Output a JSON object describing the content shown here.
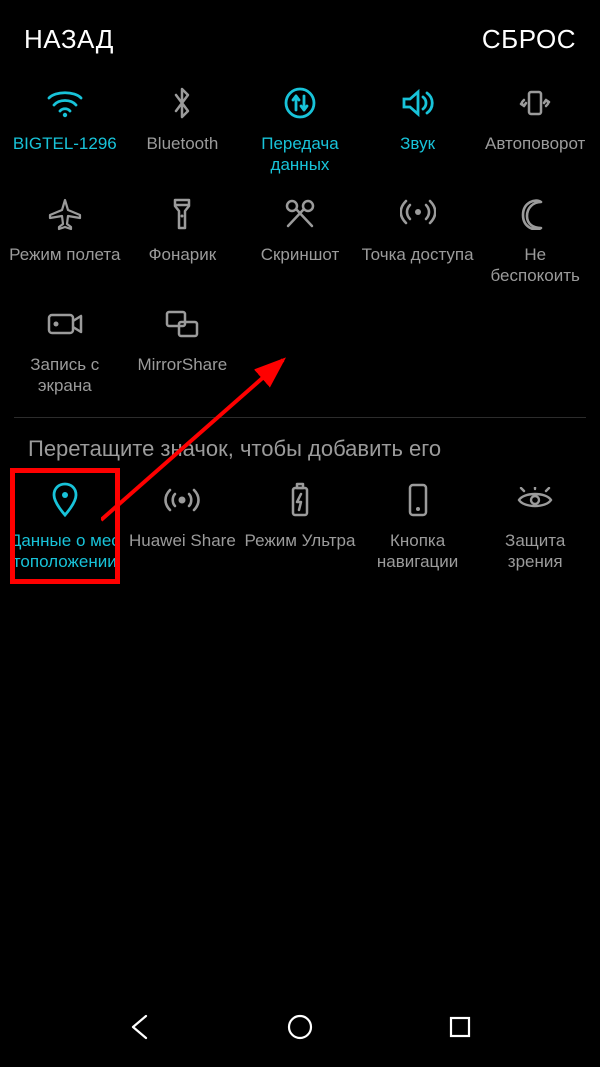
{
  "header": {
    "back": "НАЗАД",
    "reset": "СБРОС"
  },
  "hint": "Перетащите значок, чтобы добавить его",
  "colors": {
    "accent": "#18c3d9",
    "muted": "#9b9b9b",
    "highlight": "#ff0000"
  },
  "active_tiles": [
    {
      "id": "wifi",
      "label": "BIGTEL-1296",
      "active": true
    },
    {
      "id": "bluetooth",
      "label": "Bluetooth",
      "active": false
    },
    {
      "id": "data",
      "label": "Передача данных",
      "active": true
    },
    {
      "id": "sound",
      "label": "Звук",
      "active": true
    },
    {
      "id": "rotate",
      "label": "Автоповорот",
      "active": false
    },
    {
      "id": "airplane",
      "label": "Режим полета",
      "active": false
    },
    {
      "id": "flashlight",
      "label": "Фонарик",
      "active": false
    },
    {
      "id": "screenshot",
      "label": "Скриншот",
      "active": false
    },
    {
      "id": "hotspot",
      "label": "Точка доступа",
      "active": false
    },
    {
      "id": "dnd",
      "label": "Не беспокоить",
      "active": false
    },
    {
      "id": "record",
      "label": "Запись с экрана",
      "active": false
    },
    {
      "id": "mirror",
      "label": "MirrorShare",
      "active": false
    }
  ],
  "available_tiles": [
    {
      "id": "location",
      "label": "Данные о мес тоположении",
      "active": true,
      "highlighted": true
    },
    {
      "id": "huaweishare",
      "label": "Huawei Share",
      "active": false
    },
    {
      "id": "ultra",
      "label": "Режим Ультра",
      "active": false
    },
    {
      "id": "navkey",
      "label": "Кнопка навигации",
      "active": false
    },
    {
      "id": "eyecare",
      "label": "Защита зрения",
      "active": false
    }
  ]
}
